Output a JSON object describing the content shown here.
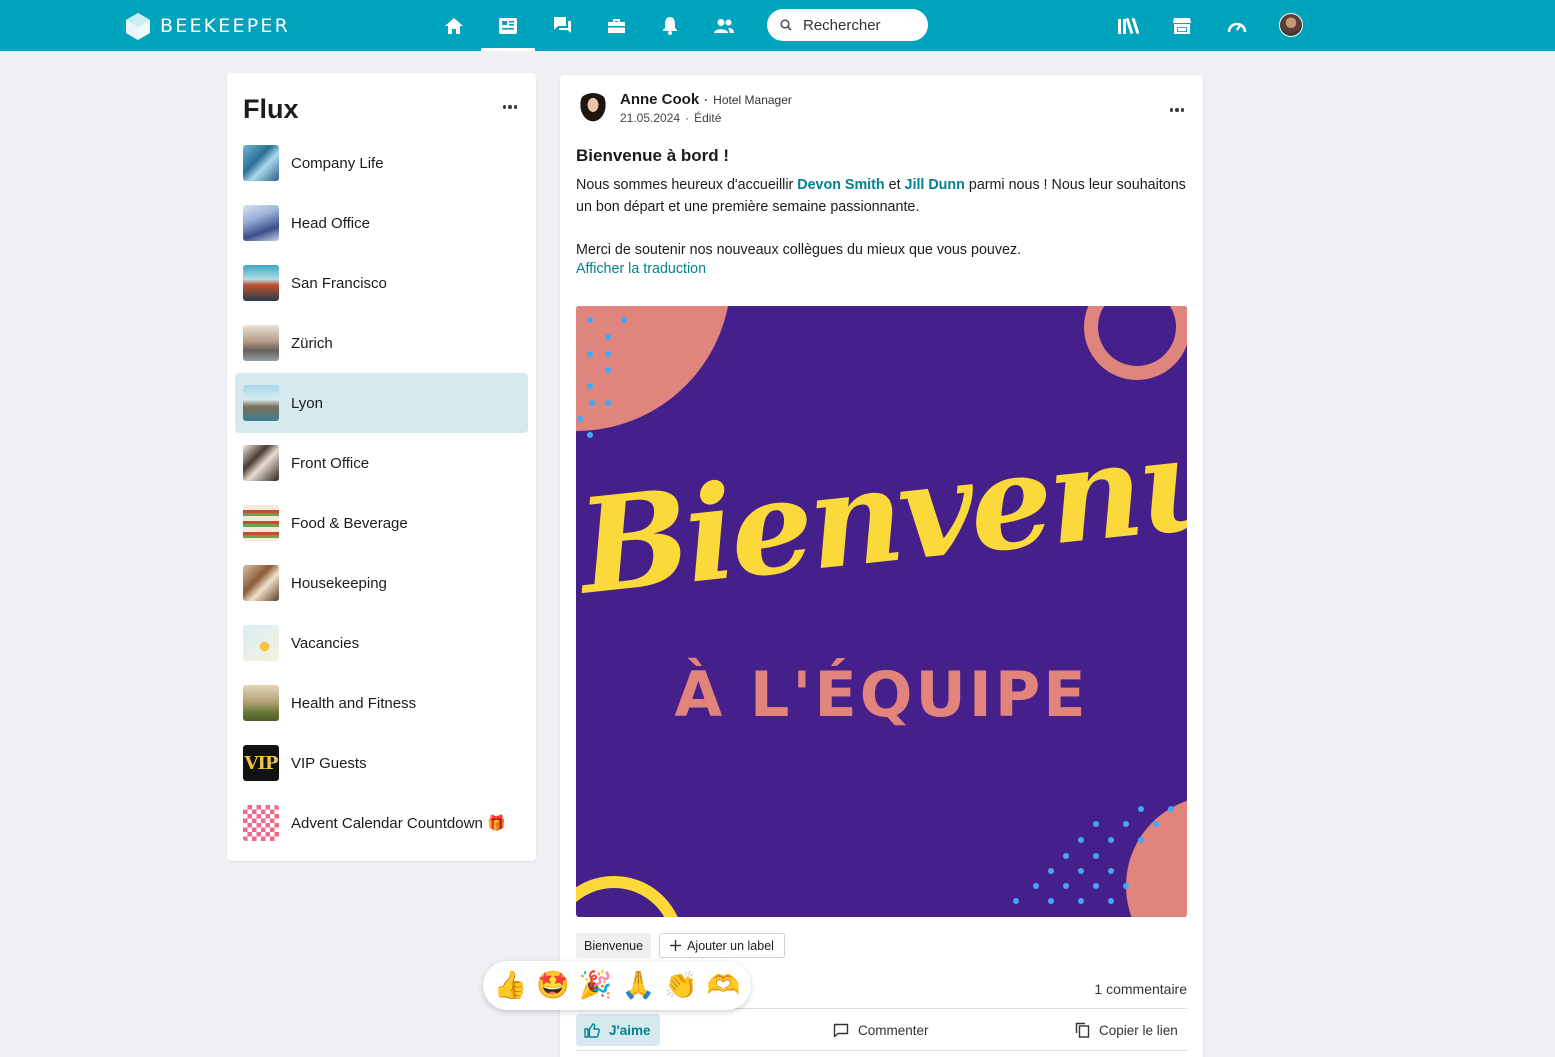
{
  "topbar": {
    "brand": "BEEKEEPER",
    "nav": [
      {
        "icon": "home-icon"
      },
      {
        "icon": "stream-icon",
        "active": true
      },
      {
        "icon": "chat-icon"
      },
      {
        "icon": "toolbox-icon"
      },
      {
        "icon": "bell-icon"
      },
      {
        "icon": "people-icon"
      }
    ],
    "search_placeholder": "Rechercher",
    "right_icons": [
      "library-icon",
      "store-icon",
      "dashboard-icon",
      "avatar"
    ]
  },
  "sidebar": {
    "title": "Flux",
    "items": [
      {
        "label": "Company Life"
      },
      {
        "label": "Head Office"
      },
      {
        "label": "San Francisco"
      },
      {
        "label": "Zürich"
      },
      {
        "label": "Lyon",
        "selected": true
      },
      {
        "label": "Front Office"
      },
      {
        "label": "Food & Beverage"
      },
      {
        "label": "Housekeeping"
      },
      {
        "label": "Vacancies"
      },
      {
        "label": "Health and Fitness"
      },
      {
        "label": "VIP Guests"
      },
      {
        "label": "Advent Calendar Countdown 🎁"
      }
    ]
  },
  "post": {
    "author": "Anne Cook",
    "role": "Hotel Manager",
    "date": "21.05.2024",
    "edited": "Édité",
    "title": "Bienvenue à bord !",
    "body_pre": "Nous sommes heureux d'accueillir ",
    "mention1": "Devon Smith",
    "body_mid": " et ",
    "mention2": "Jill Dunn",
    "body_post": " parmi nous ! Nous leur souhaitons un bon départ et une première semaine passionnante.",
    "body_p2": "Merci de soutenir nos nouveaux collègues du mieux que vous pouvez.",
    "translate": "Afficher la traduction",
    "image_text_main": "Bienvenu",
    "image_text_sub": "À L'ÉQUIPE",
    "label": "Bienvenue",
    "add_label": "Ajouter un label",
    "comment_count": "1 commentaire",
    "like": "J'aime",
    "comment": "Commenter",
    "copy_link": "Copier le lien"
  },
  "reactions": [
    "👍",
    "🤩",
    "🎉",
    "🙏",
    "👏",
    "🫶"
  ],
  "colors": {
    "topbar": "#00a3bd",
    "accent": "#00838f",
    "selected_bg": "#d6e9ee",
    "hero_bg": "#46208a",
    "hero_yellow": "#fcd93a",
    "hero_pink": "#e3847c"
  }
}
